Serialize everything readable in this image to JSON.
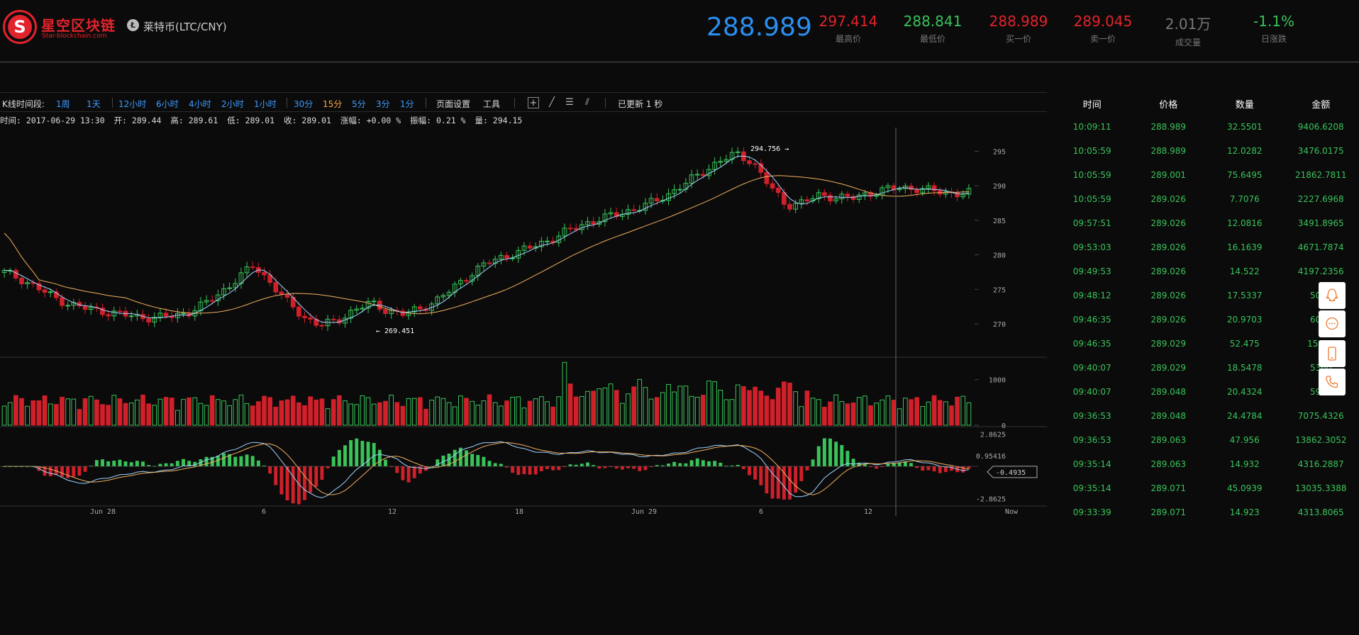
{
  "header": {
    "logo_letter": "S",
    "brand_name": "星空区块链",
    "brand_url": "Star-blockchain.com",
    "coin_symbol": "Ł",
    "coin_name": "莱特币(LTC/CNY)",
    "last_price": "288.989",
    "stats": [
      {
        "value": "297.414",
        "label": "最高价",
        "color": "#e2232b"
      },
      {
        "value": "288.841",
        "label": "最低价",
        "color": "#39c45a"
      },
      {
        "value": "288.989",
        "label": "买一价",
        "color": "#e2232b"
      },
      {
        "value": "289.045",
        "label": "卖一价",
        "color": "#e2232b"
      },
      {
        "value": "2.01万",
        "label": "成交量",
        "color": "#777777"
      },
      {
        "value": "-1.1%",
        "label": "日涨跌",
        "color": "#39c45a"
      }
    ]
  },
  "toolbar": {
    "period_label": "K线时间段:",
    "timeframes": [
      "1周",
      "1天",
      "12小时",
      "6小时",
      "4小时",
      "2小时",
      "1小时",
      "30分",
      "15分",
      "5分",
      "3分",
      "1分"
    ],
    "active_timeframe": "15分",
    "page_settings": "页面设置",
    "tools": "工具",
    "updated": "已更新 1 秒"
  },
  "infoline": {
    "time": "时间: 2017-06-29 13:30",
    "open": "开: 289.44",
    "high": "高: 289.61",
    "low": "低: 289.01",
    "close": "收: 289.01",
    "change": "涨幅: +0.00 %",
    "amplitude": "振幅: 0.21 %",
    "volume": "量: 294.15"
  },
  "chart_data": {
    "type": "candlestick",
    "price_axis_ticks": [
      "295",
      "290",
      "285",
      "280",
      "275",
      "270"
    ],
    "volume_axis_ticks": [
      "1000",
      "0"
    ],
    "macd_axis_ticks": [
      "2.8625",
      "0.95416",
      "-2.8625"
    ],
    "macd_current": "-0.4935",
    "x_labels": [
      "Jun 28",
      "6",
      "12",
      "18",
      "Jun 29",
      "6",
      "12",
      "Now"
    ],
    "max_label": "294.756",
    "min_label": "269.451",
    "price_range": [
      266,
      297
    ],
    "volume_range": [
      0,
      1400
    ],
    "macd_range": [
      -3.4,
      3.4
    ],
    "close_path": [
      277.5,
      276.5,
      275.2,
      273.8,
      272.8,
      272.2,
      271.8,
      271.4,
      271.0,
      270.9,
      271.1,
      271.6,
      272.8,
      274.5,
      276.5,
      278.5,
      276.0,
      273.2,
      271.0,
      269.8,
      270.4,
      272.0,
      273.0,
      272.0,
      271.4,
      272.2,
      273.4,
      275.2,
      277.2,
      278.8,
      279.7,
      280.5,
      281.4,
      282.4,
      283.6,
      284.6,
      285.3,
      286.0,
      286.7,
      287.6,
      288.9,
      290.4,
      292.0,
      293.6,
      294.6,
      293.5,
      290.0,
      287.2,
      287.6,
      288.6,
      288.4,
      288.2,
      288.9,
      289.5,
      289.7,
      289.6,
      289.2,
      288.9,
      289.0
    ]
  },
  "trades": {
    "headers": [
      "时间",
      "价格",
      "数量",
      "金额"
    ],
    "rows": [
      [
        "10:09:11",
        "288.989",
        "32.5501",
        "9406.6208"
      ],
      [
        "10:05:59",
        "288.989",
        "12.0282",
        "3476.0175"
      ],
      [
        "10:05:59",
        "289.001",
        "75.6495",
        "21862.7811"
      ],
      [
        "10:05:59",
        "289.026",
        "7.7076",
        "2227.6968"
      ],
      [
        "09:57:51",
        "289.026",
        "12.0816",
        "3491.8965"
      ],
      [
        "09:53:03",
        "289.026",
        "16.1639",
        "4671.7874"
      ],
      [
        "09:49:53",
        "289.026",
        "14.522",
        "4197.2356"
      ],
      [
        "09:48:12",
        "289.026",
        "17.5337",
        "5067"
      ],
      [
        "09:46:35",
        "289.026",
        "20.9703",
        "6060"
      ],
      [
        "09:46:35",
        "289.029",
        "52.475",
        "15166"
      ],
      [
        "09:40:07",
        "289.029",
        "18.5478",
        "5360"
      ],
      [
        "09:40:07",
        "289.048",
        "20.4324",
        "5905"
      ],
      [
        "09:36:53",
        "289.048",
        "24.4784",
        "7075.4326"
      ],
      [
        "09:36:53",
        "289.063",
        "47.956",
        "13862.3052"
      ],
      [
        "09:35:14",
        "289.063",
        "14.932",
        "4316.2887"
      ],
      [
        "09:35:14",
        "289.071",
        "45.0939",
        "13035.3388"
      ],
      [
        "09:33:39",
        "289.071",
        "14.923",
        "4313.8065"
      ]
    ]
  },
  "side_buttons": [
    "qq-icon",
    "chat-icon",
    "mobile-icon",
    "phone-icon"
  ]
}
